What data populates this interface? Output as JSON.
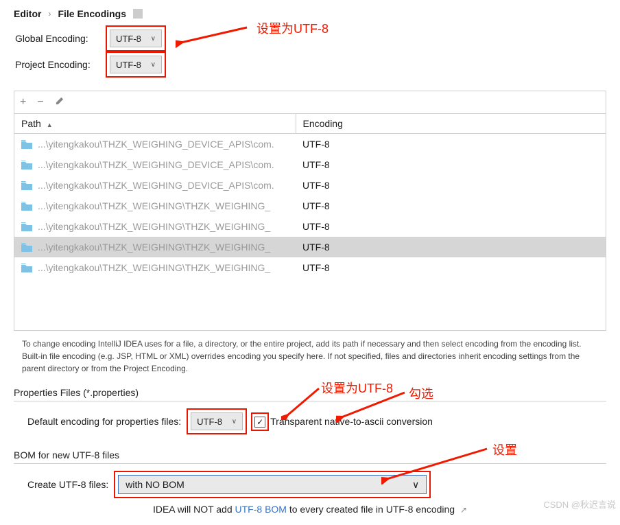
{
  "breadcrumb": {
    "parent": "Editor",
    "current": "File Encodings"
  },
  "globalEncoding": {
    "label": "Global Encoding:",
    "value": "UTF-8"
  },
  "projectEncoding": {
    "label": "Project Encoding:",
    "value": "UTF-8"
  },
  "annotations": {
    "top": "设置为UTF-8",
    "props": "设置为UTF-8",
    "check": "勾选",
    "bom": "设置"
  },
  "columns": {
    "path": "Path",
    "encoding": "Encoding"
  },
  "rows": [
    {
      "path": "...\\yitengkakou\\THZK_WEIGHING_DEVICE_APIS\\com.",
      "encoding": "UTF-8",
      "selected": false
    },
    {
      "path": "...\\yitengkakou\\THZK_WEIGHING_DEVICE_APIS\\com.",
      "encoding": "UTF-8",
      "selected": false
    },
    {
      "path": "...\\yitengkakou\\THZK_WEIGHING_DEVICE_APIS\\com.",
      "encoding": "UTF-8",
      "selected": false
    },
    {
      "path": "...\\yitengkakou\\THZK_WEIGHING\\THZK_WEIGHING_",
      "encoding": "UTF-8",
      "selected": false
    },
    {
      "path": "...\\yitengkakou\\THZK_WEIGHING\\THZK_WEIGHING_",
      "encoding": "UTF-8",
      "selected": false
    },
    {
      "path": "...\\yitengkakou\\THZK_WEIGHING\\THZK_WEIGHING_",
      "encoding": "UTF-8",
      "selected": true
    },
    {
      "path": "...\\yitengkakou\\THZK_WEIGHING\\THZK_WEIGHING_",
      "encoding": "UTF-8",
      "selected": false
    }
  ],
  "hint": "To change encoding IntelliJ IDEA uses for a file, a directory, or the entire project, add its path if necessary and then select encoding from the encoding list. Built-in file encoding (e.g. JSP, HTML or XML) overrides encoding you specify here. If not specified, files and directories inherit encoding settings from the parent directory or from the Project Encoding.",
  "propsSection": {
    "title": "Properties Files (*.properties)",
    "label": "Default encoding for properties files:",
    "value": "UTF-8",
    "checkboxLabel": "Transparent native-to-ascii conversion",
    "checked": true
  },
  "bomSection": {
    "title": "BOM for new UTF-8 files",
    "label": "Create UTF-8 files:",
    "value": "with NO BOM",
    "footPrefix": "IDEA will NOT add ",
    "footLink": "UTF-8 BOM",
    "footSuffix": " to every created file in UTF-8 encoding"
  },
  "watermark": "CSDN @秋迟言说"
}
